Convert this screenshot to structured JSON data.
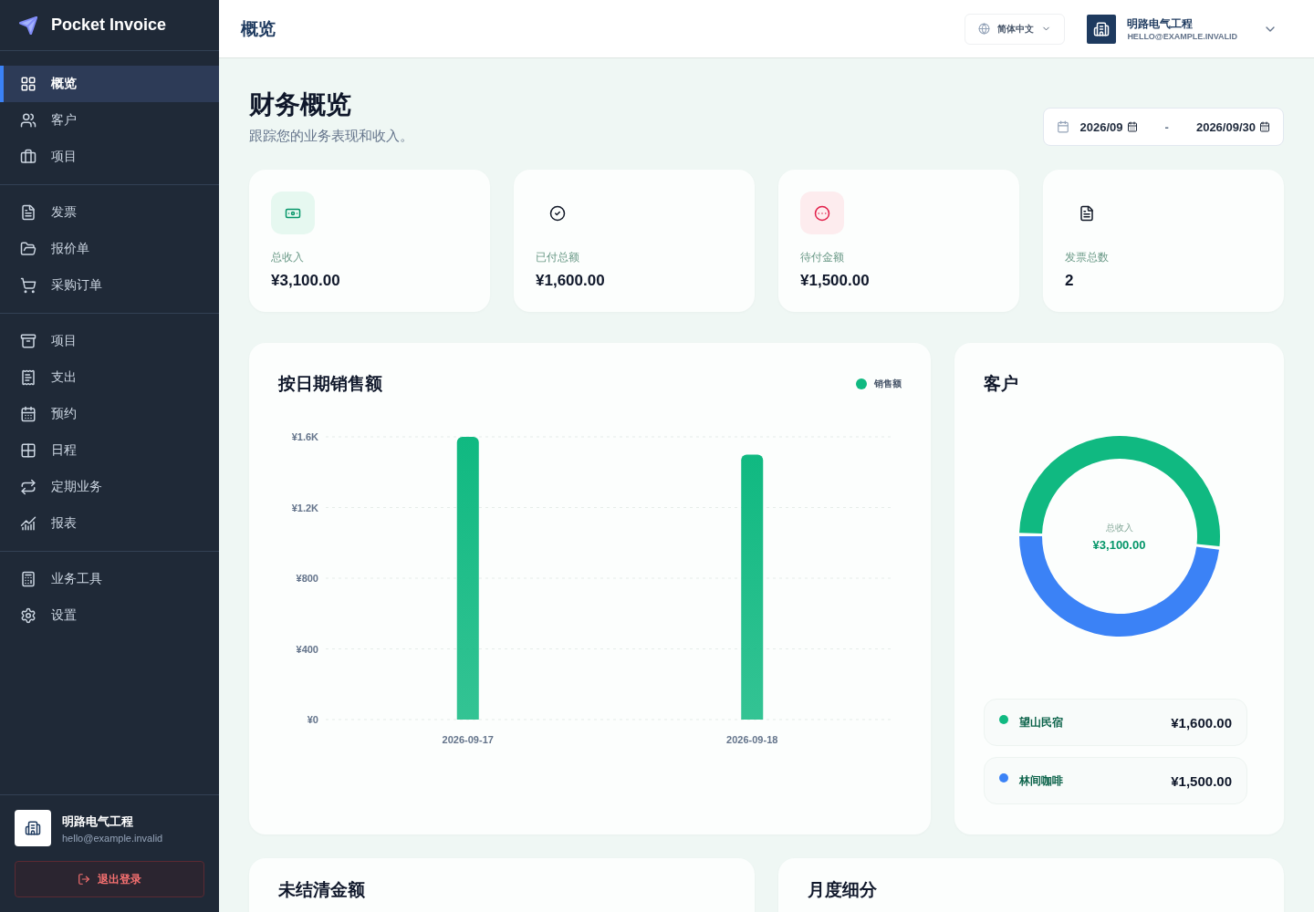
{
  "sidebar": {
    "brand": "Pocket Invoice",
    "groups": [
      {
        "items": [
          {
            "label": "概览",
            "selected": true
          },
          {
            "label": "客户",
            "selected": false
          },
          {
            "label": "项目",
            "selected": false
          }
        ]
      },
      {
        "items": [
          {
            "label": "发票",
            "selected": false
          },
          {
            "label": "报价单",
            "selected": false
          },
          {
            "label": "采购订单",
            "selected": false
          }
        ]
      },
      {
        "items": [
          {
            "label": "项目",
            "selected": false
          },
          {
            "label": "支出",
            "selected": false
          },
          {
            "label": "预约",
            "selected": false
          },
          {
            "label": "日程",
            "selected": false
          },
          {
            "label": "定期业务",
            "selected": false
          },
          {
            "label": "报表",
            "selected": false
          }
        ]
      },
      {
        "items": [
          {
            "label": "业务工具",
            "selected": false
          },
          {
            "label": "设置",
            "selected": false
          }
        ]
      }
    ],
    "account": {
      "name": "明路电气工程",
      "email": "hello@example.invalid"
    },
    "logout": "退出登录"
  },
  "header": {
    "title": "概览",
    "language": "简体中文",
    "company": "明路电气工程",
    "email": "HELLO@EXAMPLE.INVALID"
  },
  "page": {
    "title": "财务概览",
    "subtitle": "跟踪您的业务表现和收入。",
    "date_from": "2026/09",
    "separator": "-",
    "date_to": "2026/09/30"
  },
  "stats": [
    {
      "label": "总收入",
      "value": "¥3,100.00"
    },
    {
      "label": "已付总额",
      "value": "¥1,600.00"
    },
    {
      "label": "待付金额",
      "value": "¥1,500.00"
    },
    {
      "label": "发票总数",
      "value": "2"
    }
  ],
  "sales_chart": {
    "title": "按日期销售额",
    "chart_data": {
      "type": "bar",
      "categories": [
        "2026-09-17",
        "2026-09-18"
      ],
      "series": [
        {
          "name": "销售额",
          "color": "#10b981",
          "values": [
            1600,
            1500
          ]
        }
      ],
      "grid": true,
      "ylim": [
        0,
        1600
      ],
      "yticks": [
        {
          "value": 0,
          "label": "¥0"
        },
        {
          "value": 400,
          "label": "¥400"
        },
        {
          "value": 800,
          "label": "¥800"
        },
        {
          "value": 1200,
          "label": "¥1.2K"
        },
        {
          "value": 1600,
          "label": "¥1.6K"
        }
      ]
    }
  },
  "customers_chart": {
    "title": "客户",
    "center_label": "总收入",
    "center_value": "¥3,100.00",
    "chart_data": {
      "type": "donut",
      "categories": [
        "望山民宿",
        "林间咖啡"
      ],
      "values": [
        51.6,
        48.4
      ]
    },
    "legend": [
      {
        "amount": "¥1,600.00",
        "color": "#10b981"
      },
      {
        "amount": "¥1,500.00",
        "color": "#3b82f6"
      }
    ]
  },
  "bottom_cards": [
    {
      "title": "未结清金额"
    },
    {
      "title": "月度细分"
    }
  ]
}
